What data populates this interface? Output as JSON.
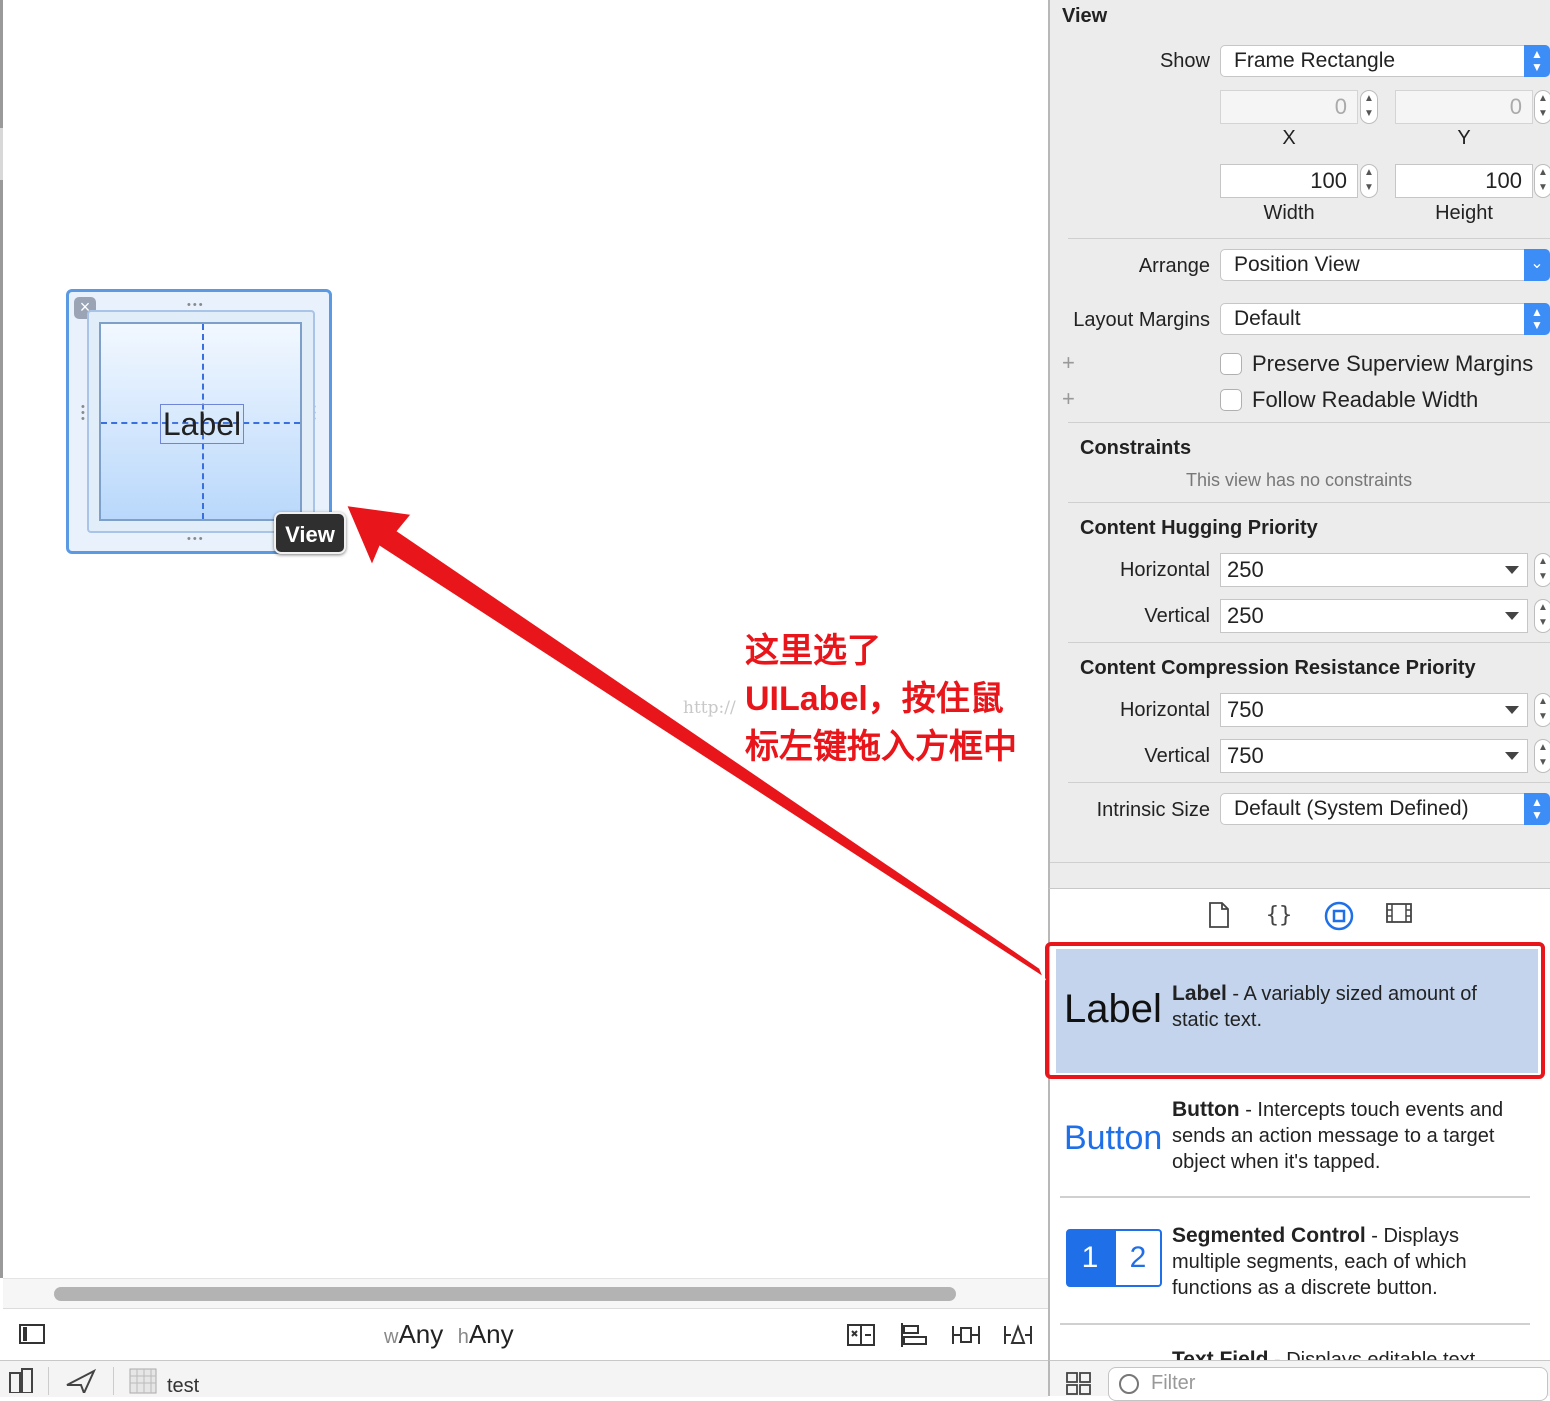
{
  "canvas": {
    "label_text": "Label",
    "view_tag": "View",
    "close_glyph": "×",
    "annotation": [
      "这里选了",
      "UILabel，按住鼠",
      "标左键拖入方框中"
    ],
    "watermark": "http://",
    "annotation_color": "#e8151a"
  },
  "bottom_bar": {
    "w_prefix": "w",
    "w_value": "Any",
    "h_prefix": "h",
    "h_value": "Any",
    "icons": [
      "embed-stack-icon",
      "align-icon",
      "pin-icon",
      "resolve-icon"
    ]
  },
  "status_bar": {
    "scheme": "test"
  },
  "inspector": {
    "title": "View",
    "show": {
      "label": "Show",
      "value": "Frame Rectangle"
    },
    "x": {
      "value": "0",
      "caption": "X"
    },
    "y": {
      "value": "0",
      "caption": "Y"
    },
    "width": {
      "value": "100",
      "caption": "Width"
    },
    "height": {
      "value": "100",
      "caption": "Height"
    },
    "arrange": {
      "label": "Arrange",
      "value": "Position View"
    },
    "layout_margins": {
      "label": "Layout Margins",
      "value": "Default"
    },
    "plus_glyph": "+",
    "preserve_superview_margins": "Preserve Superview Margins",
    "follow_readable_width": "Follow Readable Width",
    "constraints": {
      "title": "Constraints",
      "note": "This view has no constraints"
    },
    "hugging": {
      "title": "Content Hugging Priority",
      "horizontal_label": "Horizontal",
      "horizontal": "250",
      "vertical_label": "Vertical",
      "vertical": "250"
    },
    "compression": {
      "title": "Content Compression Resistance Priority",
      "horizontal_label": "Horizontal",
      "horizontal": "750",
      "vertical_label": "Vertical",
      "vertical": "750"
    },
    "intrinsic": {
      "label": "Intrinsic Size",
      "value": "Default (System Defined)"
    }
  },
  "library": {
    "tabs": [
      "file-template-icon",
      "code-snippet-icon",
      "object-library-icon",
      "media-library-icon"
    ],
    "items": [
      {
        "preview": "Label",
        "name": "Label",
        "desc": " - A variably sized amount of static text."
      },
      {
        "preview": "Button",
        "name": "Button",
        "desc": " - Intercepts touch events and sends an action message to a target object when it's tapped."
      },
      {
        "preview_1": "1",
        "preview_2": "2",
        "name": "Segmented Control",
        "desc": " - Displays multiple segments, each of which functions as a discrete button."
      },
      {
        "name": "Text Field",
        "desc": " - Displays editable text"
      }
    ],
    "filter_placeholder": "Filter",
    "accent": "#1f6fe8"
  }
}
